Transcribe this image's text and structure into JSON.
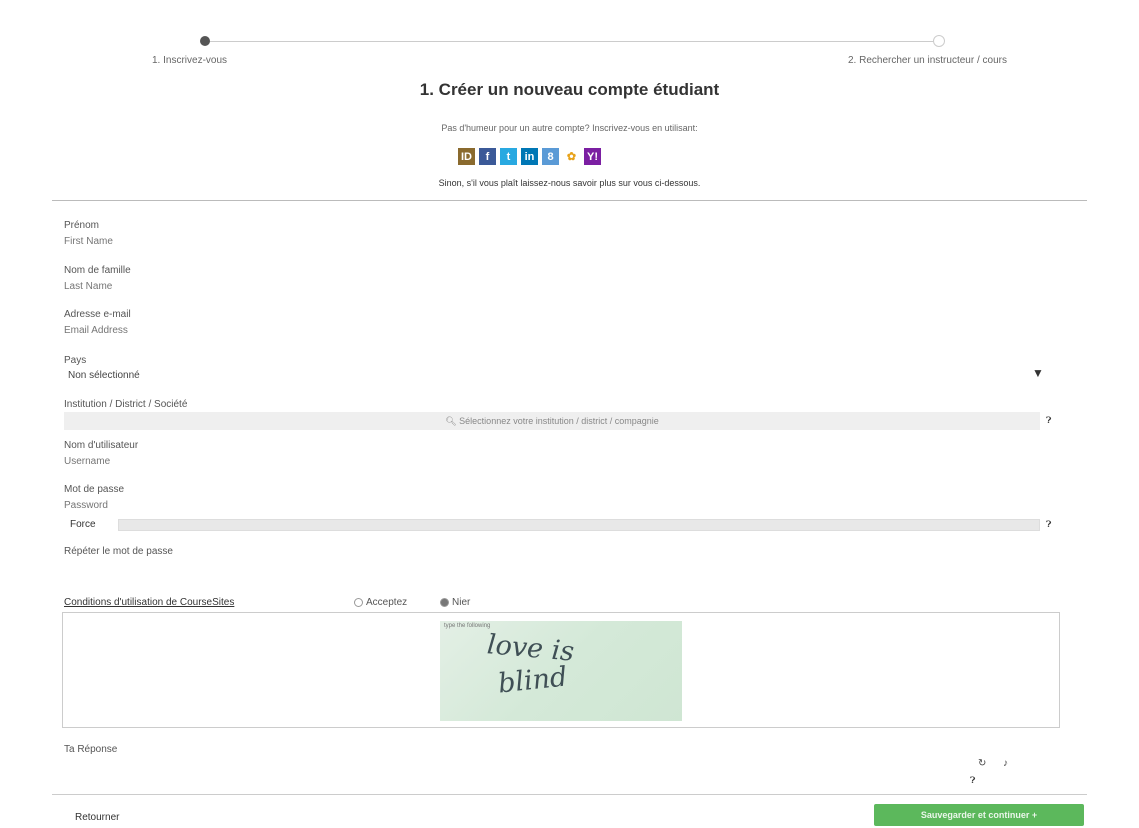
{
  "stepper": {
    "step1_label": "1. Inscrivez-vous",
    "step2_label": "2. Rechercher un instructeur / cours"
  },
  "heading": "1. Créer un nouveau compte étudiant",
  "social": {
    "prompt": "Pas d'humeur pour un autre compte? Inscrivez-vous en utilisant:",
    "providers": [
      "OpenID",
      "Facebook",
      "Twitter",
      "LinkedIn",
      "Google+",
      "Windows Live",
      "Yahoo!"
    ],
    "else_text": "Sinon, s'il vous plaît laissez-nous savoir plus sur vous ci-dessous."
  },
  "form": {
    "first_name": {
      "label": "Prénom",
      "placeholder": "First Name"
    },
    "last_name": {
      "label": "Nom de famille",
      "placeholder": "Last Name"
    },
    "email": {
      "label": "Adresse e-mail",
      "placeholder": "Email Address"
    },
    "country": {
      "label": "Pays",
      "selected": "Non sélectionné"
    },
    "institution": {
      "label": "Institution / District / Société",
      "placeholder": "Sélectionnez votre institution / district / compagnie"
    },
    "username": {
      "label": "Nom d'utilisateur",
      "placeholder": "Username"
    },
    "password": {
      "label": "Mot de passe",
      "placeholder": "Password",
      "strength_label": "Force"
    },
    "repeat_password": {
      "label": "Répéter le mot de passe"
    },
    "terms": {
      "link_text": "Conditions d'utilisation de CourseSites",
      "accept_label": "Acceptez",
      "deny_label": "Nier"
    },
    "captcha": {
      "hint": "type the following",
      "word_line1": "love is",
      "word_line2": "blind"
    },
    "answer": {
      "label": "Ta Réponse"
    }
  },
  "footer": {
    "back_label": "Retourner",
    "save_label": "Sauvegarder et continuer"
  },
  "colors": {
    "accent_green": "#5cb85c"
  }
}
